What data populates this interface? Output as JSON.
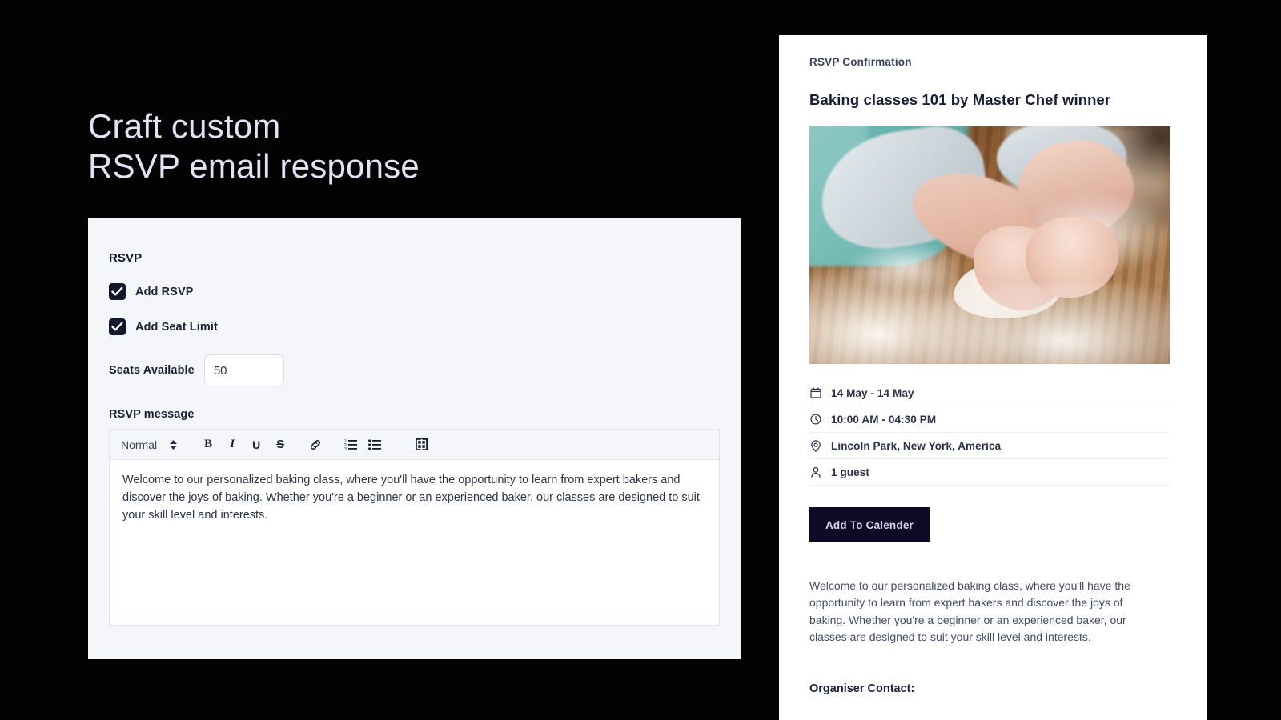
{
  "hero": {
    "title": "Craft custom\nRSVP email response",
    "title_color": "#e6e1f5"
  },
  "form": {
    "section_title": "RSVP",
    "checkboxes": [
      {
        "label": "Add RSVP",
        "checked": true
      },
      {
        "label": "Add Seat Limit",
        "checked": true
      }
    ],
    "seats": {
      "label": "Seats Available",
      "value": "50",
      "placeholder": "Seats"
    },
    "message": {
      "label": "RSVP message",
      "toolbar": {
        "format_select": "Normal",
        "buttons": [
          {
            "name": "bold-button",
            "glyph": "B"
          },
          {
            "name": "italic-button",
            "glyph": "I"
          },
          {
            "name": "underline-button",
            "glyph": "U"
          },
          {
            "name": "strikethrough-button",
            "glyph": "S"
          },
          {
            "name": "link-button",
            "glyph": "link-icon"
          },
          {
            "name": "ordered-list-button",
            "glyph": "ordered-list-icon"
          },
          {
            "name": "bullet-list-button",
            "glyph": "bullet-list-icon"
          },
          {
            "name": "insert-media-button",
            "glyph": "media-icon"
          }
        ]
      },
      "body": "Welcome to our personalized baking class, where you'll have the opportunity to learn from expert bakers and discover the joys of baking. Whether you're a beginner or an experienced baker, our classes are designed to suit your skill level and interests."
    }
  },
  "preview": {
    "eyebrow": "RSVP Confirmation",
    "title": "Baking classes 101 by Master Chef winner",
    "image_alt": "Hands kneading dough on a floured wooden table",
    "meta": [
      {
        "icon": "calendar-icon",
        "text": "14 May - 14 May"
      },
      {
        "icon": "clock-icon",
        "text": "10:00 AM - 04:30 PM"
      },
      {
        "icon": "location-pin-icon",
        "text": "Lincoln Park, New York, America"
      },
      {
        "icon": "person-icon",
        "text": "1 guest"
      }
    ],
    "calendar_button": "Add To Calender",
    "calendar_button_color": "#0d0a26",
    "description": "Welcome to our personalized baking class, where you'll have the opportunity to learn from expert bakers and discover the joys of baking. Whether you're a beginner or an experienced baker, our classes are designed to suit your skill level and interests.",
    "organiser_label": "Organiser Contact:"
  }
}
